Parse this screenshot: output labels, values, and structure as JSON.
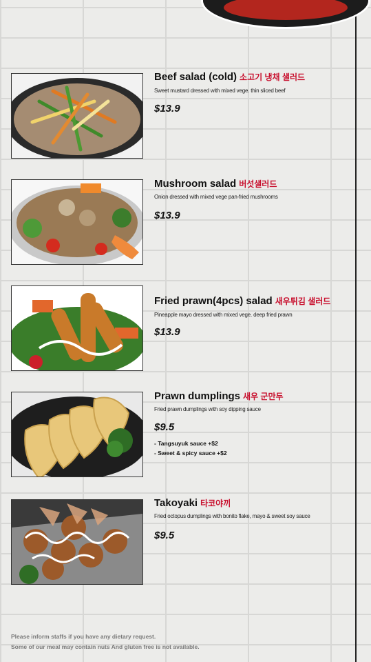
{
  "menu": {
    "items": [
      {
        "name": "Beef salad (cold)",
        "korean": "소고기 냉채 샐러드",
        "description": "Sweet mustard dressed with mixed vege. thin sliced beef",
        "price": "$13.9"
      },
      {
        "name": "Mushroom salad",
        "korean": "버섯샐러드",
        "description": "Onion dressed with mixed vege pan-fried mushrooms",
        "price": "$13.9"
      },
      {
        "name": "Fried prawn(4pcs) salad",
        "korean": "새우튀김 샐러드",
        "description": "Pineapple mayo dressed with mixed vege. deep fried prawn",
        "price": "$13.9"
      },
      {
        "name": "Prawn dumplings",
        "korean": "새우 군만두",
        "description": "Fried prawn dumplings with soy dipping sauce",
        "price": "$9.5",
        "addons": [
          "- Tangsuyuk sauce +$2",
          "- Sweet & spicy sauce +$2"
        ]
      },
      {
        "name": "Takoyaki",
        "korean": "타코야끼",
        "description": "Fried octopus dumplings with bonito flake, mayo & sweet soy sauce",
        "price": "$9.5"
      }
    ]
  },
  "footer": {
    "line1": "Please inform staffs if you have any dietary request.",
    "line2": "Some of our meal may contain nuts And gluten free is not available."
  },
  "colors": {
    "korean_text": "#c8102e",
    "divider": "#222222"
  }
}
